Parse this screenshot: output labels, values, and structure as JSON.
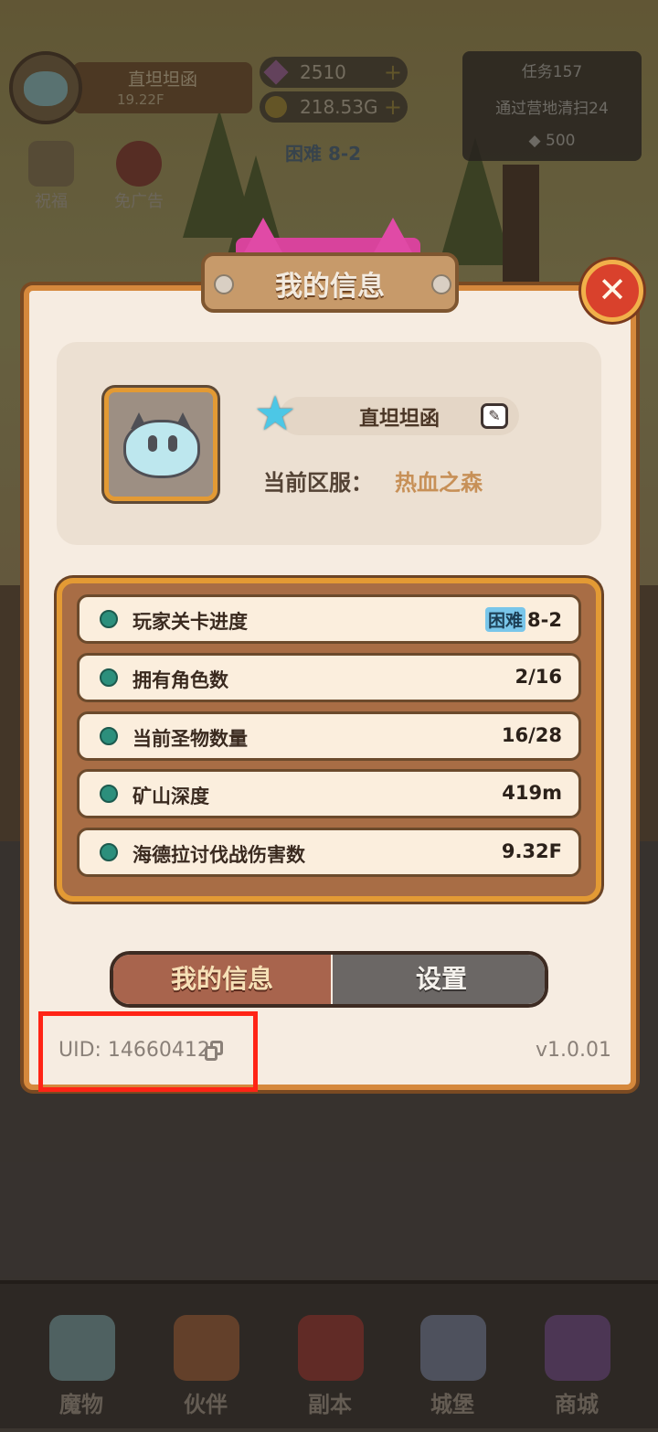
{
  "hud": {
    "player_name": "直坦坦函",
    "player_power": "19.22F",
    "gems": "2510",
    "gold": "218.53G",
    "plus": "+",
    "quest_title": "任务157",
    "quest_desc": "通过营地清扫24",
    "quest_reward": "500",
    "stage_tag": "困难 8-2",
    "side_buttons": [
      "祝福",
      "免广告"
    ]
  },
  "dialog": {
    "title": "我的信息",
    "close_glyph": "✕",
    "profile": {
      "name": "直坦坦函",
      "server_label": "当前区服：",
      "server_value": "热血之森"
    },
    "stats": [
      {
        "label": "玩家关卡进度",
        "badge": "困难",
        "value": "8-2"
      },
      {
        "label": "拥有角色数",
        "badge": "",
        "value": "2/16"
      },
      {
        "label": "当前圣物数量",
        "badge": "",
        "value": "16/28"
      },
      {
        "label": "矿山深度",
        "badge": "",
        "value": "419m"
      },
      {
        "label": "海德拉讨伐战伤害数",
        "badge": "",
        "value": "9.32F"
      }
    ],
    "tabs": {
      "active": "我的信息",
      "inactive": "设置"
    },
    "uid": "UID: 14660412",
    "version": "v1.0.01"
  },
  "bottom_nav": [
    {
      "label": "魔物",
      "color": "#6f8c8e"
    },
    {
      "label": "伙伴",
      "color": "#8e5a3a"
    },
    {
      "label": "副本",
      "color": "#8a3a34"
    },
    {
      "label": "城堡",
      "color": "#6e7488"
    },
    {
      "label": "商城",
      "color": "#6a4a7a"
    }
  ],
  "colors": {
    "accent_orange": "#e39a34",
    "close_red": "#d9412c",
    "highlight_red": "#ff2416",
    "tab_active": "#a8644d",
    "tab_inactive": "#6b6765"
  }
}
